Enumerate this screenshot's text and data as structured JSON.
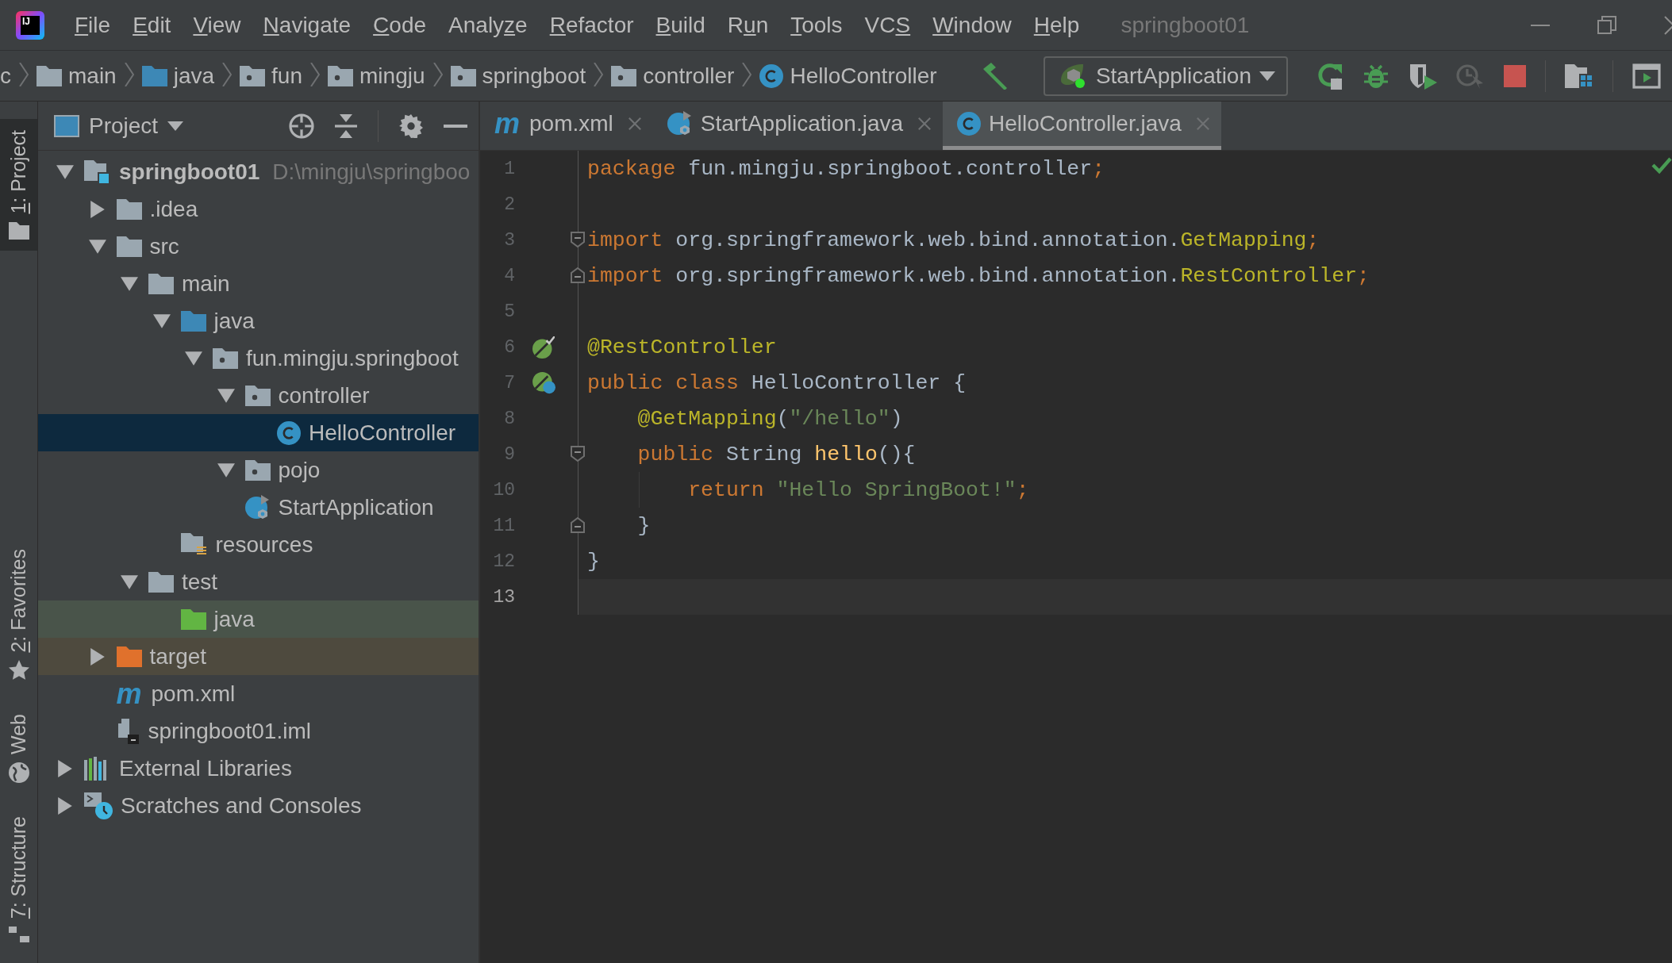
{
  "window": {
    "logo_text": "IJ",
    "title": "springboot01"
  },
  "menu": [
    {
      "key": "F",
      "after": "ile"
    },
    {
      "key": "E",
      "after": "dit"
    },
    {
      "key": "V",
      "after": "iew"
    },
    {
      "key": "N",
      "after": "avigate"
    },
    {
      "key": "C",
      "after": "ode"
    },
    {
      "before": "Analy",
      "key": "z",
      "after": "e"
    },
    {
      "key": "R",
      "after": "efactor"
    },
    {
      "key": "B",
      "after": "uild"
    },
    {
      "before": "R",
      "key": "u",
      "after": "n"
    },
    {
      "key": "T",
      "after": "ools"
    },
    {
      "before": "VC",
      "key": "S"
    },
    {
      "key": "W",
      "after": "indow"
    },
    {
      "key": "H",
      "after": "elp"
    }
  ],
  "breadcrumbs": [
    {
      "label": "c",
      "kind": "cut"
    },
    {
      "label": "main",
      "kind": "folder"
    },
    {
      "label": "java",
      "kind": "source-folder"
    },
    {
      "label": "fun",
      "kind": "package"
    },
    {
      "label": "mingju",
      "kind": "package"
    },
    {
      "label": "springboot",
      "kind": "package"
    },
    {
      "label": "controller",
      "kind": "package"
    },
    {
      "label": "HelloController",
      "kind": "class"
    }
  ],
  "run_config": {
    "label": "StartApplication"
  },
  "side_stripe": [
    {
      "key": "1",
      "after": ": Project",
      "kind": "folder",
      "selected": true
    },
    {
      "key": "2",
      "after": ": Favorites",
      "kind": "star",
      "selected": false
    },
    {
      "after": "Web",
      "kind": "globe",
      "selected": false
    },
    {
      "key": "7",
      "after": ": Structure",
      "kind": "structure",
      "selected": false
    }
  ],
  "project_panel": {
    "title": "Project",
    "tree": [
      {
        "label": "springboot01",
        "path": "D:\\mingju\\springboo",
        "kind": "module",
        "expanded": true,
        "selected": false,
        "children": [
          {
            "label": ".idea",
            "kind": "folder",
            "expanded": false,
            "selected": false
          },
          {
            "label": "src",
            "kind": "folder",
            "expanded": true,
            "selected": false,
            "children": [
              {
                "label": "main",
                "kind": "folder",
                "expanded": true,
                "selected": false,
                "children": [
                  {
                    "label": "java",
                    "kind": "source-folder",
                    "expanded": true,
                    "selected": false,
                    "children": [
                      {
                        "label": "fun.mingju.springboot",
                        "kind": "package",
                        "expanded": true,
                        "selected": false,
                        "children": [
                          {
                            "label": "controller",
                            "kind": "package",
                            "expanded": true,
                            "selected": false,
                            "children": [
                              {
                                "label": "HelloController",
                                "kind": "class",
                                "selected": true
                              }
                            ]
                          },
                          {
                            "label": "pojo",
                            "kind": "package",
                            "expanded": true,
                            "selected": false
                          },
                          {
                            "label": "StartApplication",
                            "kind": "spring-class",
                            "selected": false
                          }
                        ]
                      }
                    ]
                  },
                  {
                    "label": "resources",
                    "kind": "resources",
                    "selected": false
                  }
                ]
              },
              {
                "label": "test",
                "kind": "folder",
                "expanded": true,
                "selected": false,
                "children": [
                  {
                    "label": "java",
                    "kind": "test-folder",
                    "selected": false
                  }
                ]
              }
            ]
          },
          {
            "label": "target",
            "kind": "excluded-folder",
            "expanded": false,
            "selected": false
          },
          {
            "label": "pom.xml",
            "kind": "maven",
            "icon_text": "m",
            "selected": false
          },
          {
            "label": "springboot01.iml",
            "kind": "iml",
            "selected": false
          }
        ]
      },
      {
        "label": "External Libraries",
        "kind": "libraries",
        "expanded": false,
        "selected": false
      },
      {
        "label": "Scratches and Consoles",
        "kind": "scratches",
        "expanded": false,
        "selected": false
      }
    ]
  },
  "tabs": [
    {
      "label": "pom.xml",
      "kind": "maven",
      "icon_text": "m",
      "selected": false
    },
    {
      "label": "StartApplication.java",
      "kind": "spring-class",
      "selected": false
    },
    {
      "label": "HelloController.java",
      "kind": "class",
      "selected": true
    }
  ],
  "editor": {
    "lines": [
      {
        "number": "1",
        "tokens": [
          {
            "text": "package ",
            "kind": "keyword"
          },
          {
            "text": "fun.mingju.springboot.controller",
            "kind": "plain"
          },
          {
            "text": ";",
            "kind": "keyword"
          }
        ]
      },
      {
        "number": "2"
      },
      {
        "number": "3",
        "markers": [
          {
            "kind": "fold-start"
          }
        ],
        "tokens": [
          {
            "text": "import ",
            "kind": "keyword"
          },
          {
            "text": "org.springframework.web.bind.annotation.",
            "kind": "plain"
          },
          {
            "text": "GetMapping",
            "kind": "annotation"
          },
          {
            "text": ";",
            "kind": "keyword"
          }
        ]
      },
      {
        "number": "4",
        "markers": [
          {
            "kind": "fold-end"
          }
        ],
        "tokens": [
          {
            "text": "import ",
            "kind": "keyword"
          },
          {
            "text": "org.springframework.web.bind.annotation.",
            "kind": "plain"
          },
          {
            "text": "RestController",
            "kind": "annotation"
          },
          {
            "text": ";",
            "kind": "keyword"
          }
        ]
      },
      {
        "number": "5"
      },
      {
        "number": "6",
        "markers": [
          {
            "kind": "bean"
          }
        ],
        "tokens": [
          {
            "text": "@RestController",
            "kind": "annotation"
          }
        ]
      },
      {
        "number": "7",
        "markers": [
          {
            "kind": "class-bean"
          }
        ],
        "tokens": [
          {
            "text": "public class ",
            "kind": "keyword"
          },
          {
            "text": "HelloController {",
            "kind": "plain"
          }
        ]
      },
      {
        "number": "8",
        "tokens": [
          {
            "text": "    @GetMapping",
            "kind": "annotation"
          },
          {
            "text": "(",
            "kind": "plain"
          },
          {
            "text": "\"/hello\"",
            "kind": "string"
          },
          {
            "text": ")",
            "kind": "plain"
          }
        ]
      },
      {
        "number": "9",
        "markers": [
          {
            "kind": "fold-start"
          }
        ],
        "tokens": [
          {
            "text": "    public ",
            "kind": "keyword"
          },
          {
            "text": "String ",
            "kind": "plain"
          },
          {
            "text": "hello",
            "kind": "method"
          },
          {
            "text": "(){",
            "kind": "plain"
          }
        ]
      },
      {
        "number": "10",
        "indent_guide": true,
        "tokens": [
          {
            "text": "        return ",
            "kind": "keyword"
          },
          {
            "text": "\"Hello SpringBoot!\"",
            "kind": "string"
          },
          {
            "text": ";",
            "kind": "keyword"
          }
        ]
      },
      {
        "number": "11",
        "markers": [
          {
            "kind": "fold-end"
          }
        ],
        "tokens": [
          {
            "text": "    }",
            "kind": "plain"
          }
        ]
      },
      {
        "number": "12",
        "tokens": [
          {
            "text": "}",
            "kind": "plain"
          }
        ]
      },
      {
        "number": "13",
        "current": true
      }
    ]
  }
}
